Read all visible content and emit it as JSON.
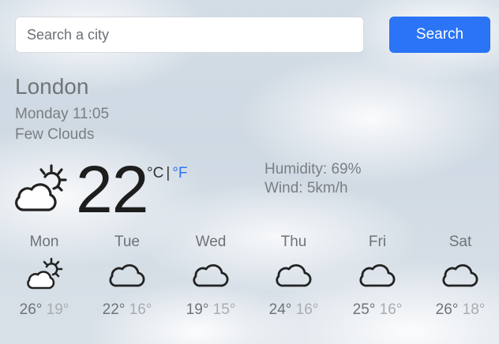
{
  "search": {
    "placeholder": "Search a city",
    "value": "",
    "button_label": "Search"
  },
  "current": {
    "city": "London",
    "datetime": "Monday 11:05",
    "condition": "Few Clouds",
    "icon": "few-clouds-icon",
    "temperature": "22",
    "unit_celsius": "°C",
    "unit_separator": "|",
    "unit_fahrenheit": "°F",
    "humidity": "Humidity: 69%",
    "wind": "Wind: 5km/h"
  },
  "forecast": [
    {
      "day": "Mon",
      "icon": "few-clouds-icon",
      "max": "26°",
      "min": "19°"
    },
    {
      "day": "Tue",
      "icon": "cloud-icon",
      "max": "22°",
      "min": "16°"
    },
    {
      "day": "Wed",
      "icon": "cloud-icon",
      "max": "19°",
      "min": "15°"
    },
    {
      "day": "Thu",
      "icon": "cloud-icon",
      "max": "24°",
      "min": "16°"
    },
    {
      "day": "Fri",
      "icon": "cloud-icon",
      "max": "25°",
      "min": "16°"
    },
    {
      "day": "Sat",
      "icon": "cloud-icon",
      "max": "26°",
      "min": "18°"
    }
  ],
  "colors": {
    "accent": "#2b74f5",
    "text_dark": "#1d1d1d",
    "text_muted": "#7a7e82",
    "text_light": "#a9adb1"
  }
}
